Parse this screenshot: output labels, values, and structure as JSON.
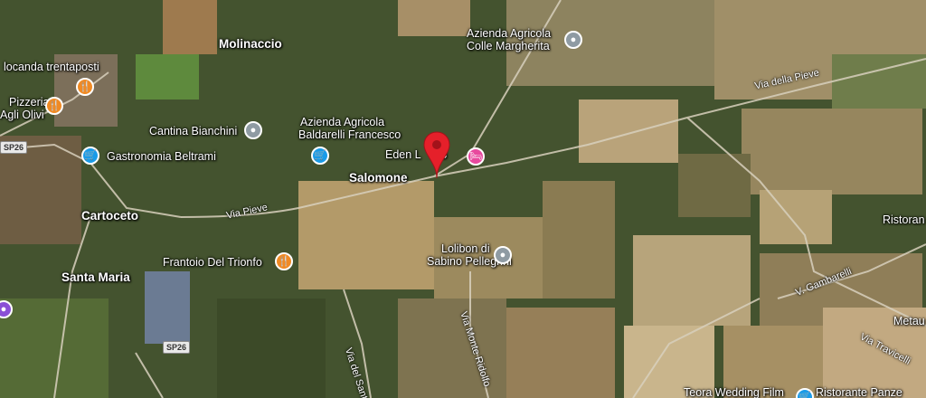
{
  "places": {
    "molinaccio": "Molinaccio",
    "locanda": "locanda trentaposti",
    "pizzeria_line1": "Pizzeria",
    "pizzeria_line2": "Agli Olivi",
    "cantina": "Cantina Bianchini",
    "gastronomia": "Gastronomia Beltrami",
    "cartoceto": "Cartoceto",
    "santa_maria": "Santa Maria",
    "frantoio": "Frantoio Del Trionfo",
    "azienda_baldarelli_line1": "Azienda Agricola",
    "azienda_baldarelli_line2": "Baldarelli Francesco",
    "salomone": "Salomone",
    "eden": "Eden L",
    "eden_suffix": "&B",
    "azienda_colle_line1": "Azienda Agricola",
    "azienda_colle_line2": "Colle Margherita",
    "lolibon_line1": "Lolibon di",
    "lolibon_line2": "Sabino Pellegrini",
    "ristorante_right": "Ristoran",
    "metau": "Metau",
    "ristorante_bottom": "Ristorante Panze",
    "teora": "Teora Wedding Film"
  },
  "roads": {
    "via_pieve": "Via Pieve",
    "via_della_pieve": "Via della Pieve",
    "v_gambarelli": "V. Gambarelli",
    "via_monte_ridolfo": "Via Monte Ridolfo",
    "via_del_santo": "Via del Santo",
    "via_travicelli": "Via Travicelli",
    "sp26_top": "SP26",
    "sp26_bottom": "SP26"
  },
  "icons": {
    "restaurant": "fork-knife-icon",
    "shopping": "shopping-cart-icon",
    "lodging": "bed-icon",
    "generic": "location-dot-icon",
    "pin": "map-pin-icon"
  },
  "colors": {
    "restaurant": "#f08a24",
    "shopping": "#1a9be8",
    "lodging": "#e8499e",
    "generic": "#8f9ba3",
    "pin": "#e5202a"
  }
}
